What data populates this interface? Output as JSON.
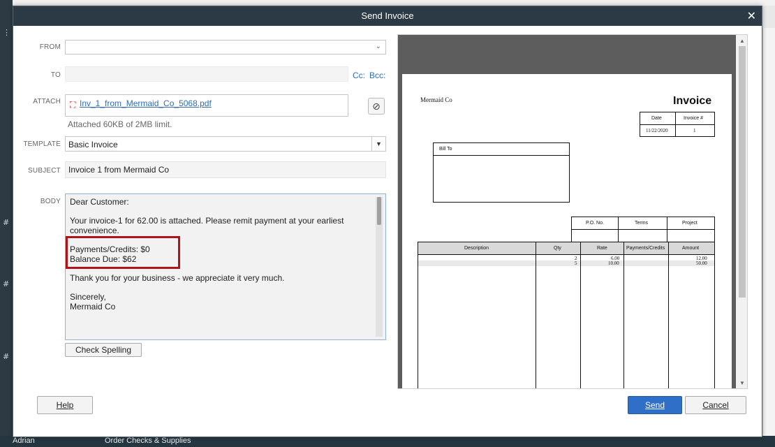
{
  "dialog": {
    "title": "Send Invoice"
  },
  "form": {
    "from_label": "FROM",
    "from_value": "",
    "to_label": "TO",
    "to_value": "",
    "cc_label": "Cc:",
    "bcc_label": "Bcc:",
    "attach_label": "ATTACH",
    "attachment_name": "Inv_1_from_Mermaid_Co_5068.pdf",
    "attach_note": "Attached 60KB of 2MB limit.",
    "template_label": "TEMPLATE",
    "template_value": "Basic Invoice",
    "subject_label": "SUBJECT",
    "subject_value": "Invoice 1 from Mermaid Co",
    "body_label": "BODY",
    "body": {
      "greeting": "Dear Customer:",
      "message": "Your invoice-1 for 62.00 is attached. Please remit payment at your earliest convenience.",
      "payments_credits": "Payments/Credits: $0",
      "balance_due": "Balance Due: $62",
      "thanks": "Thank you for your business - we appreciate it very much.",
      "closing": "Sincerely,",
      "signature": "Mermaid Co"
    },
    "check_spelling_label": "Check Spelling"
  },
  "buttons": {
    "help": "Help",
    "send": "Send",
    "cancel": "Cancel"
  },
  "preview": {
    "company": "Mermaid Co",
    "heading": "Invoice",
    "date_header": "Date",
    "invoice_no_header": "Invoice #",
    "date_value": "11/22/2020",
    "invoice_no_value": "1",
    "bill_to_label": "Bill To",
    "po_header": "P.O. No.",
    "terms_header": "Terms",
    "project_header": "Project",
    "columns": [
      "Description",
      "Qty",
      "Rate",
      "Payments/Credits",
      "Amount"
    ],
    "rows": [
      {
        "qty": "2",
        "rate": "6.00",
        "amount": "12.00"
      },
      {
        "qty": "5",
        "rate": "10.00",
        "amount": "50.00"
      }
    ]
  },
  "background": {
    "bottom_text": "Order Checks & Supplies",
    "bottom_user": "Adrian"
  },
  "colors": {
    "titlebar": "#2b3a44",
    "link": "#2e6db4",
    "highlight": "#b0141b",
    "primary_button": "#2f6fc7"
  }
}
